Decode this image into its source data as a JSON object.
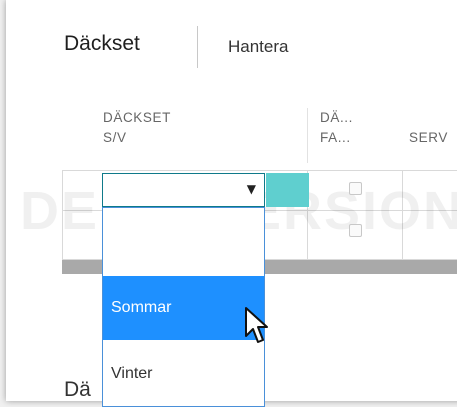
{
  "tabs": {
    "active_label": "Däckset",
    "second_label": "Hantera"
  },
  "grid": {
    "columns": [
      {
        "line1": "DÄCKSET",
        "line2": "S/V"
      },
      {
        "line1": "DÄ...",
        "line2": "FA..."
      },
      {
        "line1": "SERV"
      }
    ]
  },
  "dropdown": {
    "options": [
      "",
      "Sommar",
      "Vinter"
    ],
    "highlighted": "Sommar"
  },
  "watermark": "DEMO VERSION",
  "footer_partial": "Dä",
  "colors": {
    "focus_border": "#0f7a8a",
    "teal_cell": "#5fcfcf",
    "highlight": "#1e90ff",
    "dropdown_border": "#4a90d9"
  }
}
